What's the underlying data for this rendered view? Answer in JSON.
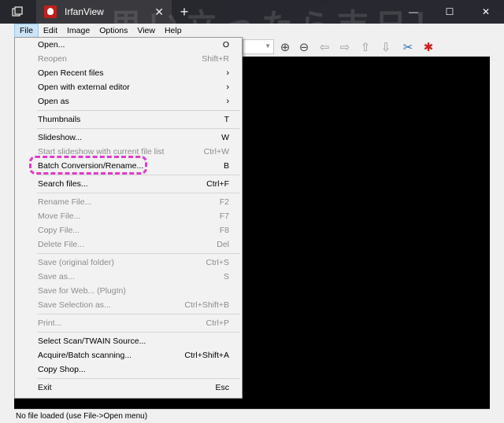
{
  "window": {
    "tab_title": "IrfanView",
    "close_glyph": "✕",
    "new_tab_glyph": "+",
    "minimize_glyph": "—",
    "maximize_glyph": "☐",
    "window_close_glyph": "✕"
  },
  "watermark": "思い立ったら吉日！",
  "menubar": [
    "File",
    "Edit",
    "Image",
    "Options",
    "View",
    "Help"
  ],
  "file_menu": [
    {
      "label": "Open...",
      "shortcut": "O",
      "enabled": true
    },
    {
      "label": "Reopen",
      "shortcut": "Shift+R",
      "enabled": false
    },
    {
      "label": "Open Recent files",
      "shortcut": "›",
      "enabled": true,
      "submenu": true
    },
    {
      "label": "Open with external editor",
      "shortcut": "›",
      "enabled": true,
      "submenu": true
    },
    {
      "label": "Open as",
      "shortcut": "›",
      "enabled": true,
      "submenu": true
    },
    {
      "separator": true
    },
    {
      "label": "Thumbnails",
      "shortcut": "T",
      "enabled": true
    },
    {
      "separator": true
    },
    {
      "label": "Slideshow...",
      "shortcut": "W",
      "enabled": true
    },
    {
      "label": "Start slideshow with current file list",
      "shortcut": "Ctrl+W",
      "enabled": false
    },
    {
      "label": "Batch Conversion/Rename...",
      "shortcut": "B",
      "enabled": true,
      "highlighted": true
    },
    {
      "separator": true
    },
    {
      "label": "Search files...",
      "shortcut": "Ctrl+F",
      "enabled": true
    },
    {
      "separator": true
    },
    {
      "label": "Rename File...",
      "shortcut": "F2",
      "enabled": false
    },
    {
      "label": "Move File...",
      "shortcut": "F7",
      "enabled": false
    },
    {
      "label": "Copy File...",
      "shortcut": "F8",
      "enabled": false
    },
    {
      "label": "Delete File...",
      "shortcut": "Del",
      "enabled": false
    },
    {
      "separator": true
    },
    {
      "label": "Save (original folder)",
      "shortcut": "Ctrl+S",
      "enabled": false
    },
    {
      "label": "Save as...",
      "shortcut": "S",
      "enabled": false
    },
    {
      "label": "Save for Web... (PlugIn)",
      "shortcut": "",
      "enabled": false
    },
    {
      "label": "Save Selection as...",
      "shortcut": "Ctrl+Shift+B",
      "enabled": false
    },
    {
      "separator": true
    },
    {
      "label": "Print...",
      "shortcut": "Ctrl+P",
      "enabled": false
    },
    {
      "separator": true
    },
    {
      "label": "Select Scan/TWAIN Source...",
      "shortcut": "",
      "enabled": true
    },
    {
      "label": "Acquire/Batch scanning...",
      "shortcut": "Ctrl+Shift+A",
      "enabled": true
    },
    {
      "label": "Copy Shop...",
      "shortcut": "",
      "enabled": true
    },
    {
      "separator": true
    },
    {
      "label": "Exit",
      "shortcut": "Esc",
      "enabled": true
    }
  ],
  "toolbar_icons": [
    {
      "name": "zoom-in-icon",
      "glyph": "⊕",
      "color": "#4a4a4a"
    },
    {
      "name": "zoom-out-icon",
      "glyph": "⊖",
      "color": "#4a4a4a"
    },
    {
      "name": "previous-arrow-icon",
      "glyph": "⇦",
      "color": "#9a9a9a"
    },
    {
      "name": "next-arrow-icon",
      "glyph": "⇨",
      "color": "#9a9a9a"
    },
    {
      "name": "upload-page-icon",
      "glyph": "⇧",
      "color": "#9a9a9a"
    },
    {
      "name": "download-page-icon",
      "glyph": "⇩",
      "color": "#9a9a9a"
    },
    {
      "name": "tools-icon",
      "glyph": "✂",
      "color": "#2b6db0"
    },
    {
      "name": "irfanview-cat-icon",
      "glyph": "✱",
      "color": "#d0201c"
    }
  ],
  "status": "No file loaded (use File->Open menu)"
}
